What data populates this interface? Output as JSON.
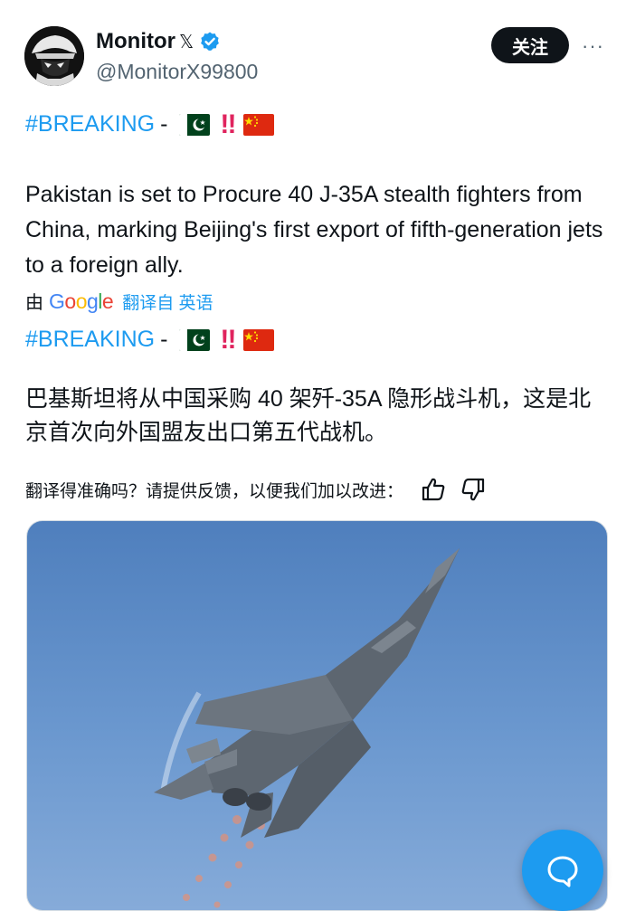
{
  "author": {
    "display_name": "Monitor",
    "x_mark": "𝕏",
    "handle": "@MonitorX99800",
    "avatar_icon": "masked-figure-avatar",
    "verified_color": "#1d9bf0"
  },
  "actions": {
    "follow_label": "关注",
    "more_label": "···"
  },
  "post": {
    "hashtag": "#BREAKING",
    "separator": "-",
    "emphasis": "‼",
    "flags": [
      "pakistan-flag",
      "china-flag"
    ],
    "body_en": "Pakistan is set to Procure 40 J-35A stealth fighters from China, marking Beijing's first export of fifth-generation jets to a foreign ally.",
    "translation_by": "由",
    "google_letters": [
      "G",
      "o",
      "o",
      "g",
      "l",
      "e"
    ],
    "translated_from": "翻译自 英语",
    "body_zh": "巴基斯坦将从中国采购 40 架歼-35A 隐形战斗机，这是北京首次向外国盟友出口第五代战机。"
  },
  "feedback": {
    "prompt": "翻译得准确吗？请提供反馈，以便我们加以改进：",
    "like_icon": "thumbs-up-icon",
    "dislike_icon": "thumbs-down-icon"
  },
  "media": {
    "description_icon": "fighter-jet-photo"
  },
  "fab": {
    "icon": "chat-bubble-icon"
  },
  "colors": {
    "accent": "#1d9bf0",
    "text": "#0f1419",
    "muted": "#536471"
  }
}
